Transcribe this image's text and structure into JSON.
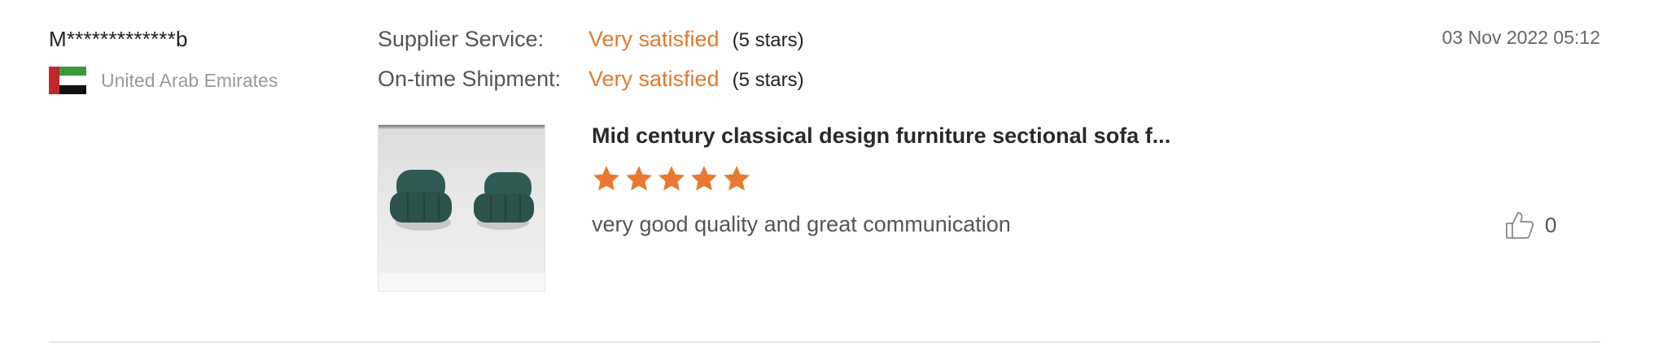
{
  "review": {
    "reviewer_name": "M*************b",
    "country": {
      "name": "United Arab Emirates",
      "flag_icon": "uae-flag-icon"
    },
    "ratings": [
      {
        "label": "Supplier Service:",
        "value": "Very satisfied",
        "stars_text": "(5 stars)"
      },
      {
        "label": "On-time Shipment:",
        "value": "Very satisfied",
        "stars_text": "(5 stars)"
      }
    ],
    "date": "03 Nov 2022 05:12",
    "product": {
      "title": "Mid century classical design furniture sectional sofa f...",
      "thumbnail_icon": "sofa-product-image",
      "rating": 5,
      "rating_max": 5
    },
    "comment": "very good quality and great communication",
    "likes": {
      "icon": "thumbs-up-icon",
      "count": "0"
    }
  },
  "colors": {
    "accent": "#e07a2e",
    "label": "#555555",
    "muted": "#999999",
    "divider": "#e3e3e3"
  }
}
